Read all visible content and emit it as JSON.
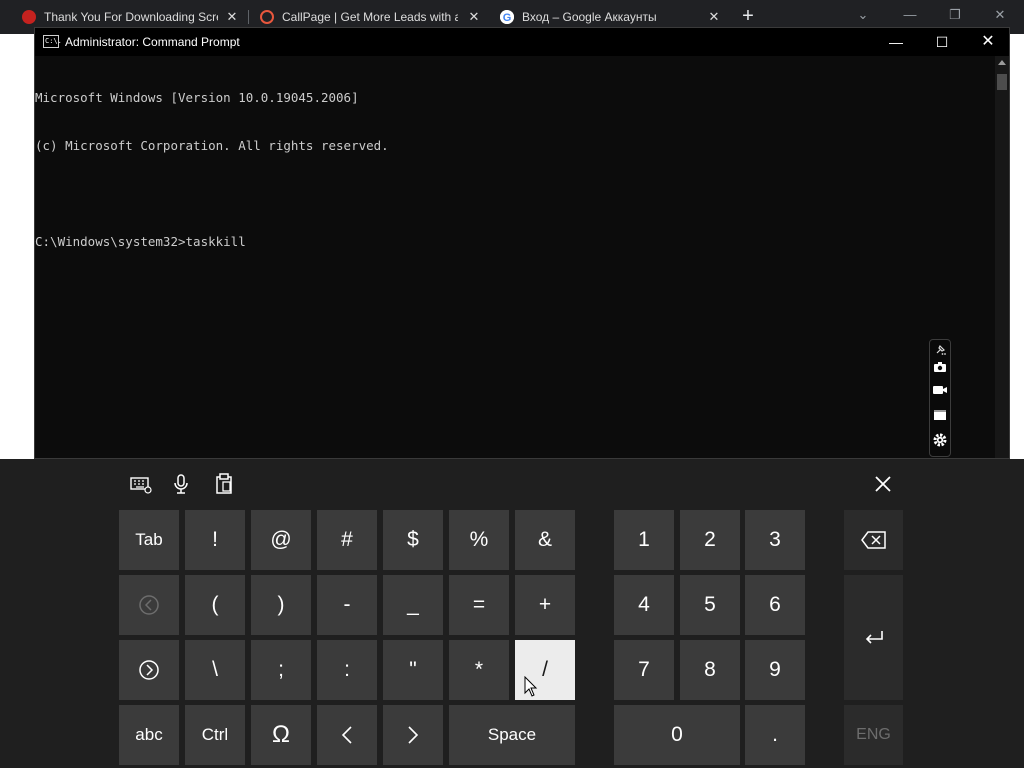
{
  "browser": {
    "tabs": [
      {
        "title": "Thank You For Downloading Scre",
        "favicon": "red-circle-icon",
        "color": "#c5221f"
      },
      {
        "title": "CallPage | Get More Leads with a",
        "favicon": "callpage-icon",
        "color": "#e8573d"
      },
      {
        "title": "Вход – Google Аккаунты",
        "favicon": "google-icon",
        "color": "#4285f4"
      }
    ],
    "new_tab_label": "+",
    "back_icon": "back-arrow-icon"
  },
  "cmd": {
    "title": "Administrator: Command Prompt",
    "icon_label": "C:\\.",
    "lines": [
      "Microsoft Windows [Version 10.0.19045.2006]",
      "(c) Microsoft Corporation. All rights reserved.",
      "",
      "C:\\Windows\\system32>taskkill"
    ]
  },
  "capture_toolbar": {
    "icons": [
      "pin-icon",
      "camera-icon",
      "video-icon",
      "window-icon",
      "gear-icon"
    ]
  },
  "keyboard": {
    "toolbar": [
      "keyboard-settings-icon",
      "microphone-icon",
      "clipboard-icon"
    ],
    "close_icon": "close-icon",
    "rows": [
      [
        "Tab",
        "!",
        "@",
        "#",
        "$",
        "%",
        "&"
      ],
      [
        "‹",
        "(",
        ")",
        "-",
        "_",
        "=",
        "+"
      ],
      [
        "›",
        "\\",
        ";",
        ":",
        "\"",
        "*",
        "/"
      ],
      [
        "abc",
        "Ctrl",
        "Ω",
        "<",
        ">",
        "Space"
      ]
    ],
    "numpad": [
      [
        "1",
        "2",
        "3"
      ],
      [
        "4",
        "5",
        "6"
      ],
      [
        "7",
        "8",
        "9"
      ],
      [
        "0",
        "."
      ]
    ],
    "side": {
      "backspace": "⌫",
      "enter": "↵",
      "language": "ENG"
    },
    "active_key": "/"
  },
  "colors": {
    "keyboard_bg": "#1f1f1f",
    "key": "#3b3b3b",
    "key_dark": "#2b2b2b",
    "key_active": "#ececec",
    "terminal_bg": "#0c0c0c",
    "terminal_text": "#cccccc"
  }
}
